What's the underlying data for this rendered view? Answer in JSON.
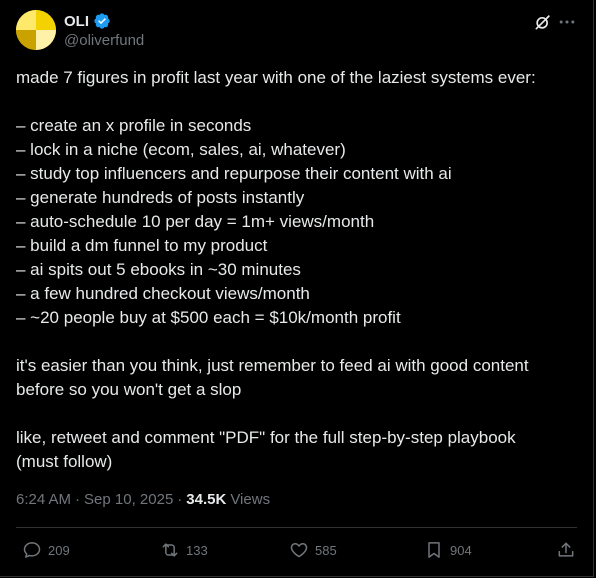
{
  "author": {
    "display_name": "OLI",
    "handle": "@oliverfund",
    "verified": true,
    "avatar_colors": [
      "#f4d100",
      "#ffe96b",
      "#c9a200",
      "#fff2a8"
    ]
  },
  "post": {
    "intro": "made 7 figures in profit last year with one of the laziest systems ever:",
    "steps": [
      "– create an x profile in seconds",
      "– lock in a niche (ecom, sales, ai, whatever)",
      "– study top influencers and repurpose their content with ai",
      "– generate hundreds of posts instantly",
      "– auto-schedule 10 per day = 1m+ views/month",
      "– build a dm funnel to my product",
      "– ai spits out 5 ebooks in ~30 minutes",
      "– a few hundred checkout views/month",
      "– ~20 people buy at $500 each = $10k/month profit"
    ],
    "paragraph_2_line_1": "it's easier than you think, just remember to feed ai with good content",
    "paragraph_2_line_2": "before so you won't get a slop",
    "paragraph_3_line_1": "like, retweet and comment \"PDF\" for the full step-by-step playbook",
    "paragraph_3_line_2": "(must follow)"
  },
  "meta": {
    "time": "6:24 AM",
    "date": "Sep 10, 2025",
    "separator": "·",
    "views_count": "34.5K",
    "views_label": "Views"
  },
  "actions": {
    "replies": "209",
    "reposts": "133",
    "likes": "585",
    "bookmarks": "904"
  },
  "colors": {
    "background": "#000000",
    "text": "#e7e9ea",
    "secondary": "#71767b",
    "verified": "#1d9bf0",
    "border": "#2f3336"
  }
}
